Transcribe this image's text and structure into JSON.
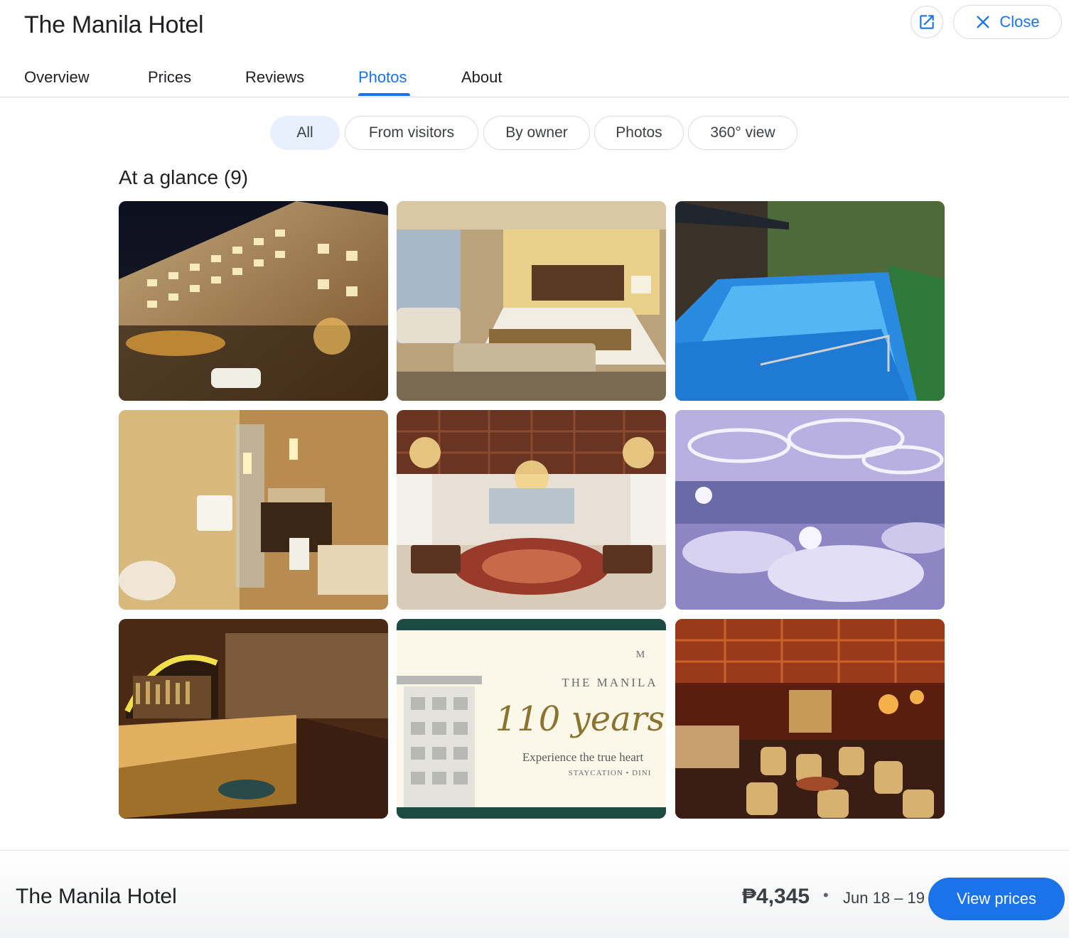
{
  "header": {
    "title": "The Manila Hotel",
    "close_label": "Close"
  },
  "tabs": [
    {
      "label": "Overview"
    },
    {
      "label": "Prices"
    },
    {
      "label": "Reviews"
    },
    {
      "label": "Photos",
      "active": true
    },
    {
      "label": "About"
    }
  ],
  "filters": [
    {
      "label": "All",
      "selected": true
    },
    {
      "label": "From visitors"
    },
    {
      "label": "By owner"
    },
    {
      "label": "Photos"
    },
    {
      "label": "360° view"
    }
  ],
  "section": {
    "title": "At a glance (9)"
  },
  "photos": [
    {
      "subject": "hotel-exterior-night"
    },
    {
      "subject": "guest-bedroom"
    },
    {
      "subject": "swimming-pool"
    },
    {
      "subject": "bathroom"
    },
    {
      "subject": "grand-lobby"
    },
    {
      "subject": "ballroom"
    },
    {
      "subject": "bar"
    },
    {
      "subject": "promo-banner",
      "text": {
        "brand": "THE MANILA",
        "headline": "110 years",
        "tagline": "Experience the true heart",
        "subline": "STAYCATION • DINI"
      }
    },
    {
      "subject": "restaurant"
    }
  ],
  "footer": {
    "name": "The Manila Hotel",
    "price": "₱4,345",
    "separator": "•",
    "dates": "Jun 18 – 19",
    "cta": "View prices"
  },
  "colors": {
    "accent": "#1a73e8",
    "chip_selected_bg": "#e8f0fe",
    "border": "#dadce0"
  }
}
